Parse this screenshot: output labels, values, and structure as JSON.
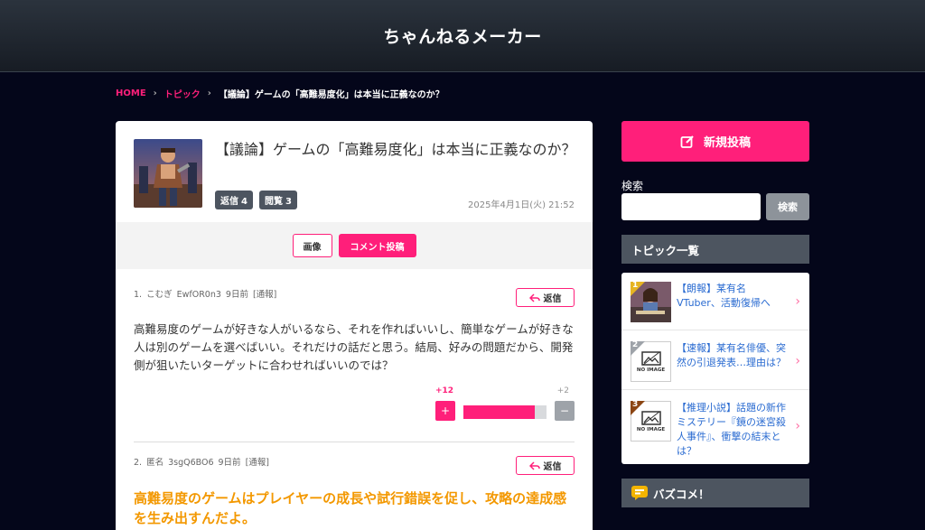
{
  "site": {
    "title": "ちゃんねるメーカー"
  },
  "breadcrumb": {
    "home": "HOME",
    "topics": "トピック",
    "current": "【議論】ゲームの「高難易度化」は本当に正義なのか？"
  },
  "topic": {
    "title": "【議論】ゲームの「高難易度化」は本当に正義なのか？",
    "reply_label": "返信",
    "reply_count": "4",
    "view_label": "閲覧",
    "view_count": "3",
    "date": "2025年4月1日(火) 21:52",
    "image_button": "画像",
    "comment_button": "コメント投稿"
  },
  "comments": [
    {
      "number": "1.",
      "name": "こむぎ",
      "id": "EwfOR0n3",
      "time": "9日前",
      "report": "[通報]",
      "reply": "返信",
      "body": "高難易度のゲームが好きな人がいるなら、それを作ればいいし、簡単なゲームが好きな人は別のゲームを選べばいい。それだけの話だと思う。結局、好みの問題だから、開発側が狙いたいターゲットに合わせればいいのでは？",
      "plus": "+12",
      "minus": "+2",
      "plus_btn": "+",
      "minus_btn": "−",
      "ratio": 0.857
    },
    {
      "number": "2.",
      "name": "匿名",
      "id": "3sgQ6BO6",
      "time": "9日前",
      "report": "[通報]",
      "reply": "返信",
      "body": "高難易度のゲームはプレイヤーの成長や試行錯誤を促し、攻略の達成感を生み出すんだよ。"
    }
  ],
  "sidebar": {
    "new_post": "新規投稿",
    "search_label": "検索",
    "search_placeholder": "",
    "search_button": "検索",
    "topic_list_title": "トピック一覧",
    "no_image": "NO IMAGE",
    "topics": [
      {
        "rank": "1",
        "title": "【朗報】某有名VTuber、活動復帰へ",
        "rank_color": "#e6b422"
      },
      {
        "rank": "2",
        "title": "【速報】某有名俳優、突然の引退発表…理由は？",
        "rank_color": "#9ea3a9"
      },
      {
        "rank": "3",
        "title": "【推理小説】話題の新作ミステリー『鏡の迷宮殺人事件』、衝撃の結末とは？",
        "rank_color": "#8b4513"
      }
    ],
    "buzz_title": "バズコメ！"
  },
  "colors": {
    "accent": "#ff1f7a",
    "background": "#04061a",
    "dark_box": "#4d5560",
    "highlight_text": "#f39800",
    "link": "#2a6bd1"
  }
}
